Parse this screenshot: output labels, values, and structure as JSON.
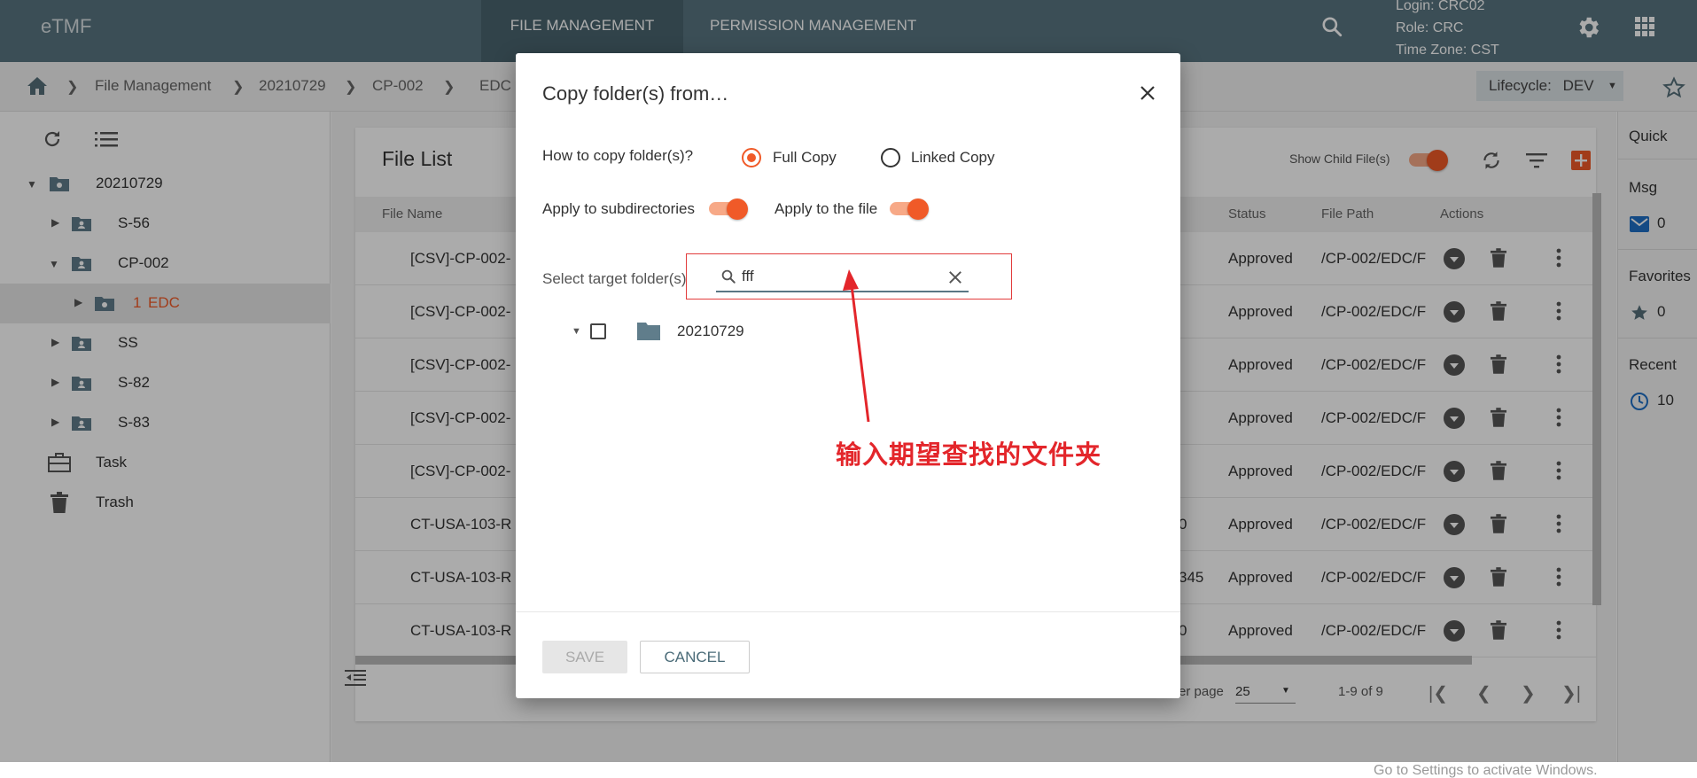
{
  "app": {
    "logo": "eTMF"
  },
  "nav": {
    "file_management": "FILE MANAGEMENT",
    "permission_management": "PERMISSION MANAGEMENT"
  },
  "user": {
    "login": "Login: CRC02",
    "role": "Role: CRC",
    "timezone": "Time Zone: CST"
  },
  "breadcrumb": [
    "File Management",
    "20210729",
    "CP-002",
    "EDC"
  ],
  "lifecycle": {
    "label": "Lifecycle:",
    "value": "DEV"
  },
  "sidebar": {
    "tree": [
      {
        "label": "20210729"
      },
      {
        "label": "S-56"
      },
      {
        "label": "CP-002"
      },
      {
        "badge": "1",
        "label": "EDC"
      },
      {
        "label": "SS"
      },
      {
        "label": "S-82"
      },
      {
        "label": "S-83"
      }
    ],
    "task": "Task",
    "trash": "Trash"
  },
  "filelist": {
    "title": "File List",
    "show_child_label": "Show Child File(s)",
    "columns": {
      "file_name": "File Name",
      "status": "Status",
      "file_path": "File Path",
      "actions": "Actions"
    },
    "rows": [
      {
        "name": "[CSV]-CP-002-",
        "partial": "",
        "status": "Approved",
        "path": "/CP-002/EDC/F"
      },
      {
        "name": "[CSV]-CP-002-",
        "partial": "",
        "status": "Approved",
        "path": "/CP-002/EDC/F"
      },
      {
        "name": "[CSV]-CP-002-",
        "partial": "",
        "status": "Approved",
        "path": "/CP-002/EDC/F"
      },
      {
        "name": "[CSV]-CP-002-",
        "partial": "",
        "status": "Approved",
        "path": "/CP-002/EDC/F"
      },
      {
        "name": "[CSV]-CP-002-",
        "partial": "",
        "status": "Approved",
        "path": "/CP-002/EDC/F"
      },
      {
        "name": "CT-USA-103-R",
        "partial": "0",
        "status": "Approved",
        "path": "/CP-002/EDC/F"
      },
      {
        "name": "CT-USA-103-R",
        "partial": "345",
        "status": "Approved",
        "path": "/CP-002/EDC/F"
      },
      {
        "name": "CT-USA-103-R",
        "partial": "0",
        "status": "Approved",
        "path": "/CP-002/EDC/F"
      }
    ],
    "pagination": {
      "per_page_label": "er page",
      "per_page": "25",
      "range": "1-9 of 9"
    }
  },
  "quick": {
    "title": "Quick",
    "msg": "Msg",
    "msg_count": "0",
    "favorites": "Favorites",
    "fav_count": "0",
    "recent": "Recent",
    "recent_count": "10"
  },
  "dialog": {
    "title": "Copy folder(s) from…",
    "how_label": "How to copy folder(s)?",
    "full_copy": "Full Copy",
    "linked_copy": "Linked Copy",
    "apply_subdirs": "Apply to subdirectories",
    "apply_file": "Apply to the file",
    "target_label": "Select target folder(s)",
    "search_value": "fff",
    "tree_root": "20210729",
    "save": "SAVE",
    "cancel": "CANCEL"
  },
  "annotation": {
    "text": "输入期望查找的文件夹"
  },
  "watermark": "Go to Settings to activate Windows."
}
